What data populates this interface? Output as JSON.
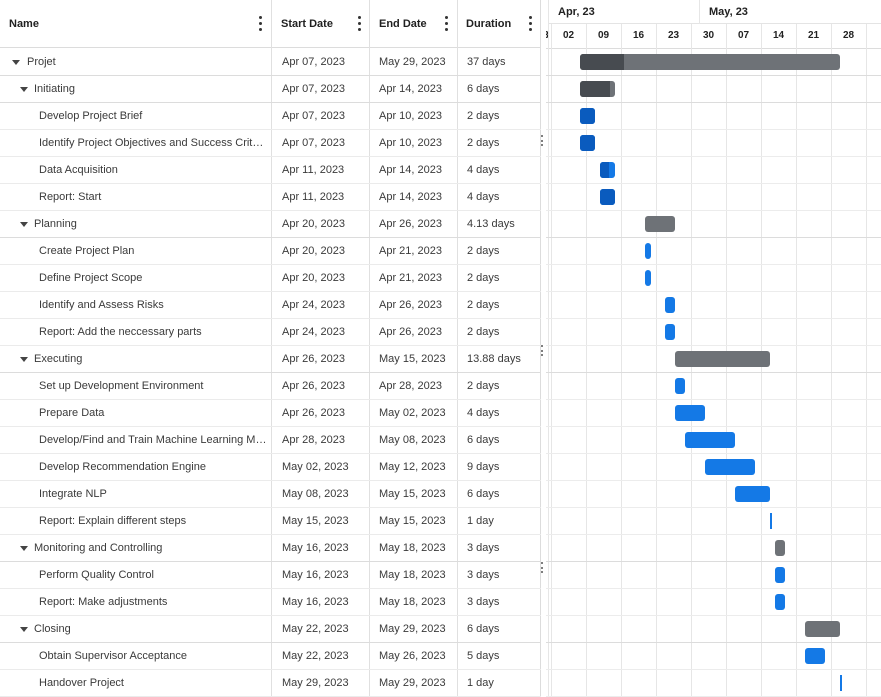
{
  "columns": {
    "name": "Name",
    "start": "Start Date",
    "end": "End Date",
    "duration": "Duration"
  },
  "timeline": {
    "months": [
      "Apr, 23",
      "May, 23"
    ],
    "weeks": [
      "02",
      "09",
      "16",
      "23",
      "30",
      "07",
      "14",
      "21",
      "28"
    ],
    "cutoff_left_label": "3"
  },
  "colors": {
    "summary_bar": "#6e7277",
    "summary_progress": "#474b50",
    "task_bar": "#1479e6",
    "task_progress": "#0a5bbe"
  },
  "tasks": [
    {
      "name": "Projet",
      "start": "Apr 07, 2023",
      "end": "May 29, 2023",
      "duration": "37 days",
      "level": 0,
      "type": "summary",
      "startDay": 0,
      "lengthDays": 52,
      "progress": 0.17
    },
    {
      "name": "Initiating",
      "start": "Apr 07, 2023",
      "end": "Apr 14, 2023",
      "duration": "6 days",
      "level": 1,
      "type": "summary",
      "startDay": 0,
      "lengthDays": 7,
      "progress": 0.85
    },
    {
      "name": "Develop Project Brief",
      "start": "Apr 07, 2023",
      "end": "Apr 10, 2023",
      "duration": "2 days",
      "level": 2,
      "type": "task",
      "startDay": 0,
      "lengthDays": 3,
      "progress": 1
    },
    {
      "name": "Identify Project Objectives and Success Criteria",
      "start": "Apr 07, 2023",
      "end": "Apr 10, 2023",
      "duration": "2 days",
      "level": 2,
      "type": "task",
      "startDay": 0,
      "lengthDays": 3,
      "progress": 1
    },
    {
      "name": "Data Acquisition",
      "start": "Apr 11, 2023",
      "end": "Apr 14, 2023",
      "duration": "4 days",
      "level": 2,
      "type": "task",
      "startDay": 4,
      "lengthDays": 3,
      "progress": 0.6
    },
    {
      "name": "Report: Start",
      "start": "Apr 11, 2023",
      "end": "Apr 14, 2023",
      "duration": "4 days",
      "level": 2,
      "type": "task",
      "startDay": 4,
      "lengthDays": 3,
      "progress": 1
    },
    {
      "name": "Planning",
      "start": "Apr 20, 2023",
      "end": "Apr 26, 2023",
      "duration": "4.13 days",
      "level": 1,
      "type": "summary",
      "startDay": 13,
      "lengthDays": 6,
      "progress": 0
    },
    {
      "name": "Create Project Plan",
      "start": "Apr 20, 2023",
      "end": "Apr 21, 2023",
      "duration": "2 days",
      "level": 2,
      "type": "task",
      "startDay": 13,
      "lengthDays": 1,
      "progress": 0
    },
    {
      "name": "Define Project Scope",
      "start": "Apr 20, 2023",
      "end": "Apr 21, 2023",
      "duration": "2 days",
      "level": 2,
      "type": "task",
      "startDay": 13,
      "lengthDays": 1,
      "progress": 0
    },
    {
      "name": "Identify and Assess Risks",
      "start": "Apr 24, 2023",
      "end": "Apr 26, 2023",
      "duration": "2 days",
      "level": 2,
      "type": "task",
      "startDay": 17,
      "lengthDays": 2,
      "progress": 0
    },
    {
      "name": "Report: Add the neccessary parts",
      "start": "Apr 24, 2023",
      "end": "Apr 26, 2023",
      "duration": "2 days",
      "level": 2,
      "type": "task",
      "startDay": 17,
      "lengthDays": 2,
      "progress": 0
    },
    {
      "name": "Executing",
      "start": "Apr 26, 2023",
      "end": "May 15, 2023",
      "duration": "13.88 days",
      "level": 1,
      "type": "summary",
      "startDay": 19,
      "lengthDays": 19,
      "progress": 0
    },
    {
      "name": "Set up Development Environment",
      "start": "Apr 26, 2023",
      "end": "Apr 28, 2023",
      "duration": "2 days",
      "level": 2,
      "type": "task",
      "startDay": 19,
      "lengthDays": 2,
      "progress": 0
    },
    {
      "name": "Prepare Data",
      "start": "Apr 26, 2023",
      "end": "May 02, 2023",
      "duration": "4 days",
      "level": 2,
      "type": "task",
      "startDay": 19,
      "lengthDays": 6,
      "progress": 0
    },
    {
      "name": "Develop/Find and Train Machine Learning Mo...",
      "start": "Apr 28, 2023",
      "end": "May 08, 2023",
      "duration": "6 days",
      "level": 2,
      "type": "task",
      "startDay": 21,
      "lengthDays": 10,
      "progress": 0
    },
    {
      "name": "Develop Recommendation Engine",
      "start": "May 02, 2023",
      "end": "May 12, 2023",
      "duration": "9 days",
      "level": 2,
      "type": "task",
      "startDay": 25,
      "lengthDays": 10,
      "progress": 0
    },
    {
      "name": "Integrate NLP",
      "start": "May 08, 2023",
      "end": "May 15, 2023",
      "duration": "6 days",
      "level": 2,
      "type": "task",
      "startDay": 31,
      "lengthDays": 7,
      "progress": 0
    },
    {
      "name": "Report: Explain different steps",
      "start": "May 15, 2023",
      "end": "May 15, 2023",
      "duration": "1 day",
      "level": 2,
      "type": "milestone",
      "startDay": 38,
      "lengthDays": 0,
      "progress": 0
    },
    {
      "name": "Monitoring and Controlling",
      "start": "May 16, 2023",
      "end": "May 18, 2023",
      "duration": "3 days",
      "level": 1,
      "type": "summary",
      "startDay": 39,
      "lengthDays": 2,
      "progress": 0
    },
    {
      "name": "Perform Quality Control",
      "start": "May 16, 2023",
      "end": "May 18, 2023",
      "duration": "3 days",
      "level": 2,
      "type": "task",
      "startDay": 39,
      "lengthDays": 2,
      "progress": 0
    },
    {
      "name": "Report: Make adjustments",
      "start": "May 16, 2023",
      "end": "May 18, 2023",
      "duration": "3 days",
      "level": 2,
      "type": "task",
      "startDay": 39,
      "lengthDays": 2,
      "progress": 0
    },
    {
      "name": "Closing",
      "start": "May 22, 2023",
      "end": "May 29, 2023",
      "duration": "6 days",
      "level": 1,
      "type": "summary",
      "startDay": 45,
      "lengthDays": 7,
      "progress": 0
    },
    {
      "name": "Obtain Supervisor Acceptance",
      "start": "May 22, 2023",
      "end": "May 26, 2023",
      "duration": "5 days",
      "level": 2,
      "type": "task",
      "startDay": 45,
      "lengthDays": 4,
      "progress": 0
    },
    {
      "name": "Handover Project",
      "start": "May 29, 2023",
      "end": "May 29, 2023",
      "duration": "1 day",
      "level": 2,
      "type": "milestone",
      "startDay": 52,
      "lengthDays": 0,
      "progress": 0
    }
  ]
}
